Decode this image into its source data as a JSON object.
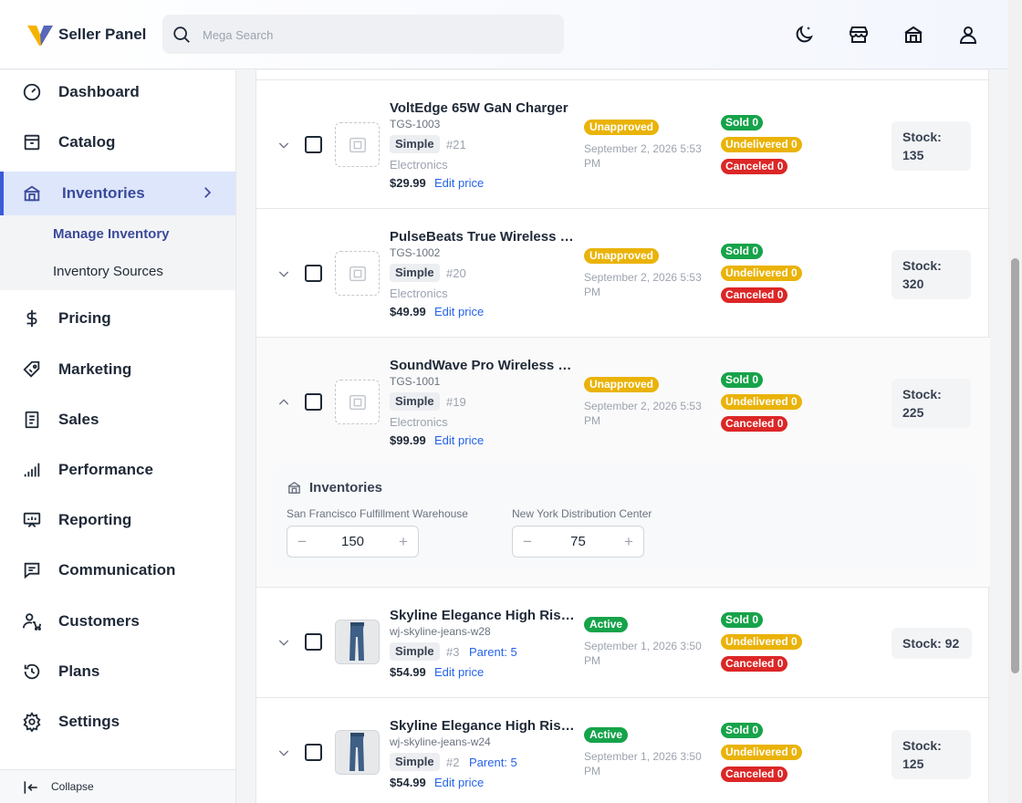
{
  "header": {
    "brand": "Seller Panel",
    "search_placeholder": "Mega Search",
    "icons": [
      "theme-toggle-icon",
      "storefront-icon",
      "store-icon",
      "user-icon"
    ]
  },
  "sidebar": {
    "items": [
      {
        "key": "dashboard",
        "label": "Dashboard",
        "icon": "gauge-icon"
      },
      {
        "key": "catalog",
        "label": "Catalog",
        "icon": "archive-icon"
      },
      {
        "key": "inventories",
        "label": "Inventories",
        "icon": "warehouse-icon",
        "active": true
      },
      {
        "key": "pricing",
        "label": "Pricing",
        "icon": "dollar-icon"
      },
      {
        "key": "marketing",
        "label": "Marketing",
        "icon": "tag-icon"
      },
      {
        "key": "sales",
        "label": "Sales",
        "icon": "receipt-icon"
      },
      {
        "key": "performance",
        "label": "Performance",
        "icon": "signal-bars-icon"
      },
      {
        "key": "reporting",
        "label": "Reporting",
        "icon": "presentation-icon"
      },
      {
        "key": "communication",
        "label": "Communication",
        "icon": "chat-icon"
      },
      {
        "key": "customers",
        "label": "Customers",
        "icon": "customer-cart-icon"
      },
      {
        "key": "plans",
        "label": "Plans",
        "icon": "history-icon"
      },
      {
        "key": "settings",
        "label": "Settings",
        "icon": "gear-icon"
      }
    ],
    "sub_items": [
      {
        "label": "Manage Inventory",
        "active": true
      },
      {
        "label": "Inventory Sources"
      }
    ],
    "collapse_label": "Collapse"
  },
  "products": [
    {
      "name": "VoltEdge 65W GaN Charger",
      "sku": "TGS-1003",
      "type": "Simple",
      "id": "#21",
      "category": "Electronics",
      "price": "$29.99",
      "edit_label": "Edit price",
      "status": "Unapproved",
      "date": "September 2, 2026 5:53 PM",
      "sold": "Sold 0",
      "undelivered": "Undelivered 0",
      "canceled": "Canceled 0",
      "stock": "Stock: 135"
    },
    {
      "name": "PulseBeats True Wireless E...",
      "sku": "TGS-1002",
      "type": "Simple",
      "id": "#20",
      "category": "Electronics",
      "price": "$49.99",
      "edit_label": "Edit price",
      "status": "Unapproved",
      "date": "September 2, 2026 5:53 PM",
      "sold": "Sold 0",
      "undelivered": "Undelivered 0",
      "canceled": "Canceled 0",
      "stock": "Stock: 320"
    },
    {
      "name": "SoundWave Pro Wireless H...",
      "sku": "TGS-1001",
      "type": "Simple",
      "id": "#19",
      "category": "Electronics",
      "price": "$99.99",
      "edit_label": "Edit price",
      "status": "Unapproved",
      "date": "September 2, 2026 5:53 PM",
      "sold": "Sold 0",
      "undelivered": "Undelivered 0",
      "canceled": "Canceled 0",
      "stock": "Stock: 225",
      "expanded": true
    },
    {
      "name": "Skyline Elegance High Rise...",
      "sku": "wj-skyline-jeans-w28",
      "type": "Simple",
      "id": "#3",
      "parent": "Parent: 5",
      "price": "$54.99",
      "edit_label": "Edit price",
      "status": "Active",
      "date": "September 1, 2026 3:50 PM",
      "sold": "Sold 0",
      "undelivered": "Undelivered 0",
      "canceled": "Canceled 0",
      "stock": "Stock: 92"
    },
    {
      "name": "Skyline Elegance High Rise...",
      "sku": "wj-skyline-jeans-w24",
      "type": "Simple",
      "id": "#2",
      "parent": "Parent: 5",
      "price": "$54.99",
      "edit_label": "Edit price",
      "status": "Active",
      "date": "September 1, 2026 3:50 PM",
      "sold": "Sold 0",
      "undelivered": "Undelivered 0",
      "canceled": "Canceled 0",
      "stock": "Stock: 125"
    }
  ],
  "inventories": {
    "title": "Inventories",
    "sources": [
      {
        "name": "San Francisco Fulfillment Warehouse",
        "qty": "150",
        "minus": "−",
        "plus": "+"
      },
      {
        "name": "New York Distribution Center",
        "qty": "75",
        "minus": "−",
        "plus": "+"
      }
    ]
  },
  "colors": {
    "accent": "#3b5bdb",
    "active_bg": "#dde6fb",
    "unapproved": "#eab308",
    "active_status": "#16a34a",
    "sold": "#16a34a",
    "undelivered": "#eab308",
    "canceled": "#dc2626",
    "link": "#2563eb"
  }
}
